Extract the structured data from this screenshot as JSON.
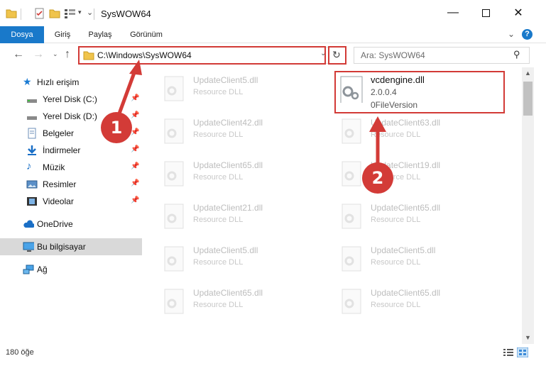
{
  "window": {
    "title": "SysWOW64",
    "minimize_icon": "minimize-icon",
    "maximize_icon": "maximize-icon",
    "close_icon": "close-icon"
  },
  "ribbon": {
    "tabs": [
      "Dosya",
      "Giriş",
      "Paylaş",
      "Görünüm"
    ],
    "accent": "#1979ca"
  },
  "address": {
    "path": "C:\\Windows\\SysWOW64",
    "search_placeholder": "Ara: SysWOW64"
  },
  "sidebar": {
    "items": [
      {
        "label": "Hızlı erişim",
        "icon": "star-icon"
      },
      {
        "label": "Yerel Disk (C:)",
        "icon": "drive-icon",
        "pinned": true
      },
      {
        "label": "Yerel Disk (D:)",
        "icon": "drive-icon",
        "pinned": true
      },
      {
        "label": "Belgeler",
        "icon": "documents-icon",
        "pinned": true
      },
      {
        "label": "İndirmeler",
        "icon": "download-icon",
        "pinned": true
      },
      {
        "label": "Müzik",
        "icon": "music-icon",
        "pinned": true
      },
      {
        "label": "Resimler",
        "icon": "pictures-icon",
        "pinned": true
      },
      {
        "label": "Videolar",
        "icon": "videos-icon",
        "pinned": true
      },
      {
        "label": "OneDrive",
        "icon": "cloud-icon"
      },
      {
        "label": "Bu bilgisayar",
        "icon": "computer-icon",
        "selected": true
      },
      {
        "label": "Ağ",
        "icon": "network-icon"
      }
    ]
  },
  "files": {
    "left": [
      {
        "name": "UpdateClient5.dll",
        "type": "Resource DLL"
      },
      {
        "name": "UpdateClient42.dll",
        "type": "Resource DLL"
      },
      {
        "name": "UpdateClient65.dll",
        "type": "Resource DLL"
      },
      {
        "name": "UpdateClient21.dll",
        "type": "Resource DLL"
      },
      {
        "name": "UpdateClient5.dll",
        "type": "Resource DLL"
      },
      {
        "name": "UpdateClient65.dll",
        "type": "Resource DLL"
      }
    ],
    "right": [
      {
        "name": "vcdengine.dll",
        "version": "2.0.0.4",
        "type": "0FileVersion",
        "active": true
      },
      {
        "name": "UpdateClient63.dll",
        "type": "Resource DLL"
      },
      {
        "name": "UpdateClient19.dll",
        "type": "Resource DLL"
      },
      {
        "name": "UpdateClient65.dll",
        "type": "Resource DLL"
      },
      {
        "name": "UpdateClient5.dll",
        "type": "Resource DLL"
      },
      {
        "name": "UpdateClient65.dll",
        "type": "Resource DLL"
      }
    ]
  },
  "status": {
    "count": "180 öğe"
  },
  "callouts": [
    "1",
    "2"
  ],
  "colors": {
    "highlight": "#d23a36",
    "callout": "#d33b37"
  }
}
